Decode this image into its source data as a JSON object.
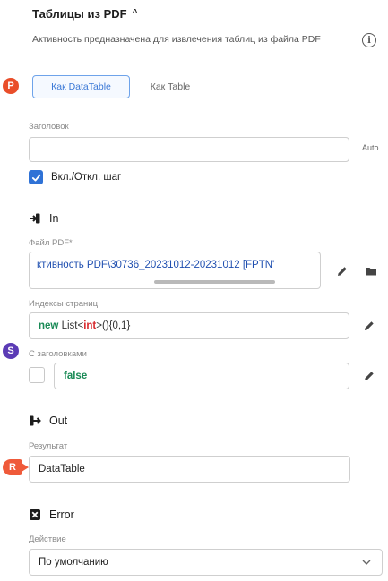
{
  "header": {
    "title": "Таблицы из PDF",
    "description": "Активность предназначена для извлечения таблиц из файла PDF"
  },
  "markers": {
    "p": "P",
    "s": "S",
    "r": "R"
  },
  "mode_tabs": [
    {
      "label": "Как DataTable",
      "active": true
    },
    {
      "label": "Как Table",
      "active": false
    }
  ],
  "heading_field": {
    "label": "Заголовок",
    "value": "",
    "auto_label": "Auto"
  },
  "toggle_step": {
    "label": "Вкл./Откл. шаг",
    "checked": true
  },
  "in_section": {
    "title": "In",
    "pdf_file": {
      "label": "Файл PDF*",
      "value": "ктивность PDF\\30736_20231012-20231012 [FPTN'"
    },
    "page_indexes": {
      "label": "Индексы страниц",
      "kw_new": "new",
      "text_before": " List<",
      "kw_int": "int",
      "text_after": ">(){0,1}"
    },
    "with_headers": {
      "label": "С заголовками",
      "checked": false,
      "value": "false"
    }
  },
  "out_section": {
    "title": "Out",
    "result": {
      "label": "Результат",
      "value": "DataTable"
    }
  },
  "error_section": {
    "title": "Error",
    "action": {
      "label": "Действие",
      "selected": "По умолчанию"
    }
  },
  "colors": {
    "accent": "#2f72d6",
    "keyword_green": "#1a8a56",
    "keyword_red": "#d6262a",
    "marker_p": "#e94e2a",
    "marker_s": "#5b3bb5",
    "marker_r": "#ef5a3a"
  }
}
